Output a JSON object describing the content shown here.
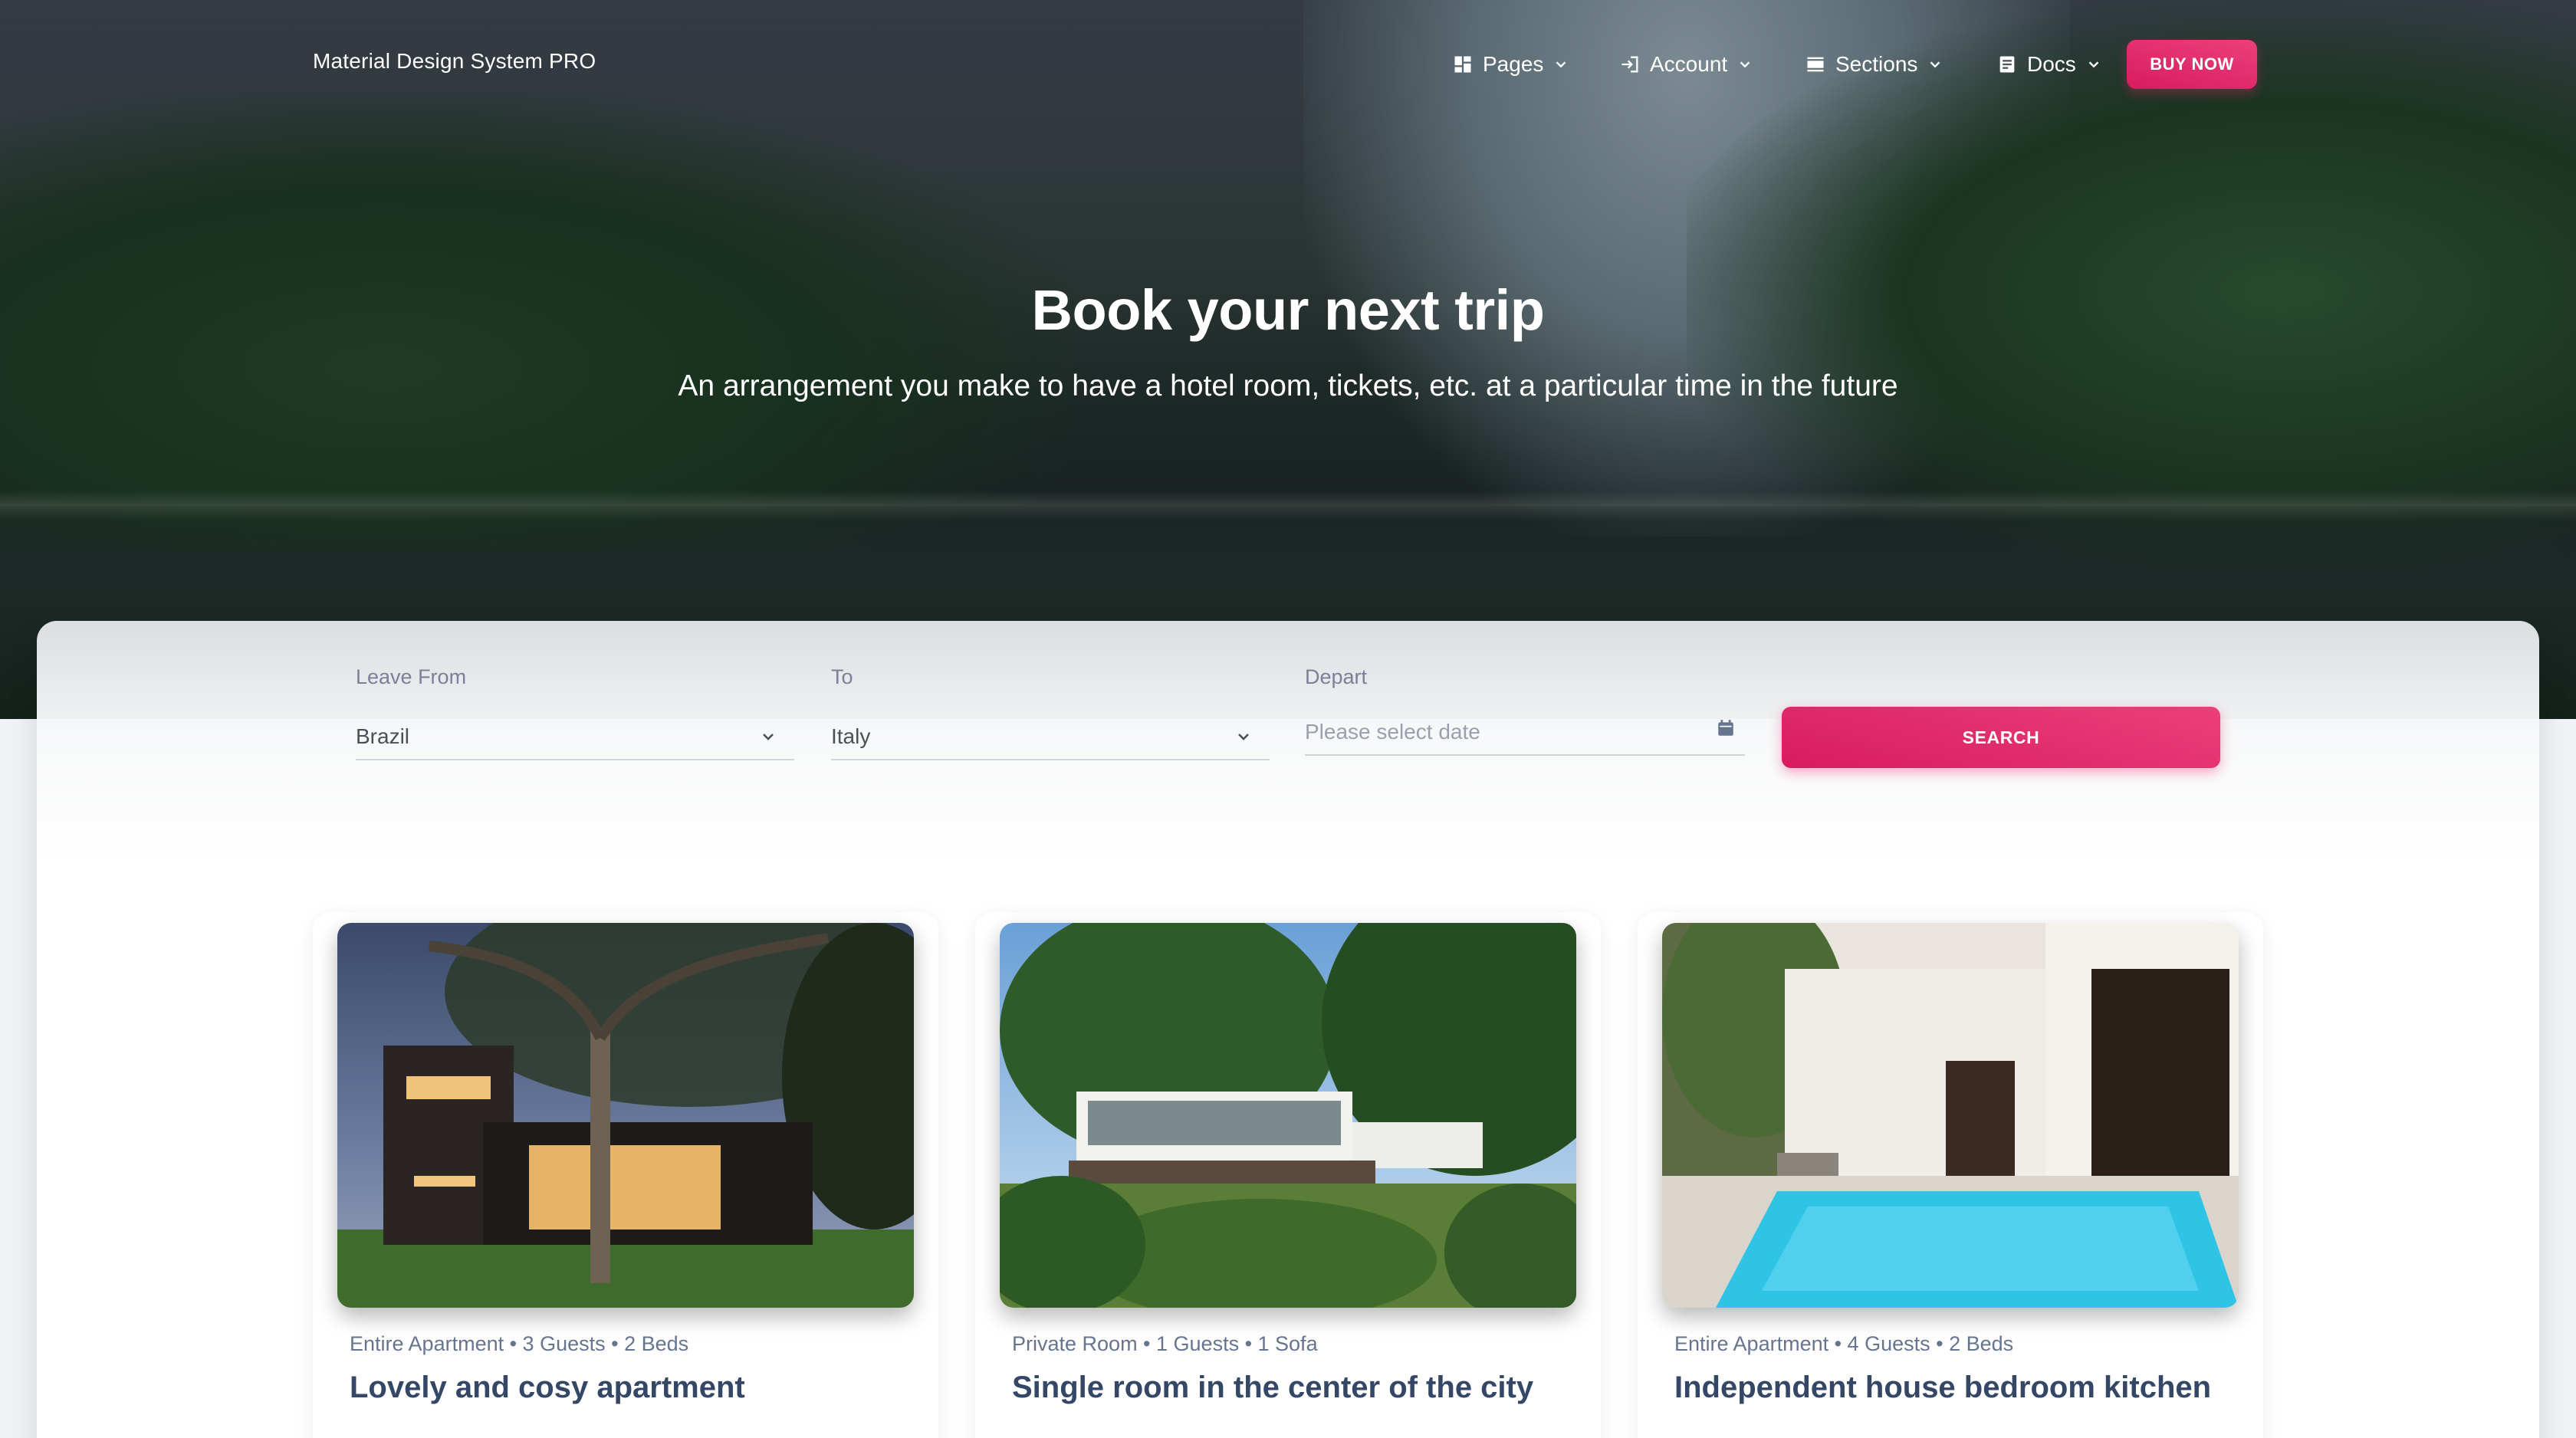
{
  "navbar": {
    "brand": "Material Design System PRO",
    "items": [
      {
        "label": "Pages",
        "icon": "dashboard-icon"
      },
      {
        "label": "Account",
        "icon": "login-icon"
      },
      {
        "label": "Sections",
        "icon": "view-day-icon"
      },
      {
        "label": "Docs",
        "icon": "article-icon"
      }
    ],
    "buy_label": "BUY NOW"
  },
  "hero": {
    "title": "Book your next trip",
    "subtitle": "An arrangement you make to have a hotel room, tickets, etc. at a particular time in the future"
  },
  "search": {
    "leave_from": {
      "label": "Leave From",
      "value": "Brazil"
    },
    "to": {
      "label": "To",
      "value": "Italy"
    },
    "depart": {
      "label": "Depart",
      "placeholder": "Please select date"
    },
    "button_label": "SEARCH"
  },
  "listings": [
    {
      "meta": "Entire Apartment • 3 Guests • 2 Beds",
      "title": "Lovely and cosy apartment"
    },
    {
      "meta": "Private Room • 1 Guests • 1 Sofa",
      "title": "Single room in the center of the city"
    },
    {
      "meta": "Entire Apartment • 4 Guests • 2 Beds",
      "title": "Independent house bedroom kitchen"
    }
  ],
  "colors": {
    "primary": "#e91e63",
    "heading": "#344767",
    "muted": "#7b809a"
  }
}
